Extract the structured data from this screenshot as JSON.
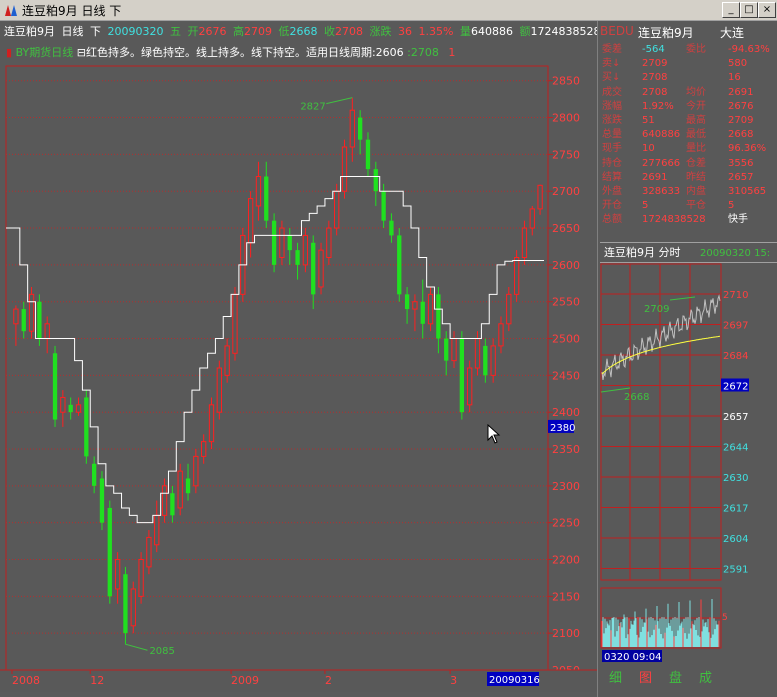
{
  "window": {
    "title": "连豆粕9月  日线  下",
    "min_label": "_",
    "max_label": "□",
    "close_label": "×"
  },
  "quote_bar": {
    "name": "连豆粕9月",
    "period": "日线",
    "direction": "下",
    "date": "20090320",
    "weekday": "五",
    "open_label": "开",
    "open": "2676",
    "high_label": "高",
    "high": "2709",
    "low_label": "低",
    "low": "2668",
    "close_label": "收",
    "close": "2708",
    "change_label": "涨跌",
    "change": "36",
    "pct": "1.35%",
    "vol_label": "量",
    "vol": "640886",
    "amt_label": "额",
    "amt": "1724838528",
    "oi_label": "仓",
    "oi": "2776"
  },
  "indicator_bar": {
    "name": "BY期货日线",
    "desc": "红色持多。绿色持空。线上持多。线下持空。适用日线周期:2606",
    "val1": ":2708",
    "val2": "1"
  },
  "chart_data": {
    "type": "candlestick",
    "y_ticks": [
      "2850",
      "2800",
      "2750",
      "2700",
      "2650",
      "2600",
      "2550",
      "2500",
      "2450",
      "2400",
      "2350",
      "2300",
      "2250",
      "2200",
      "2150",
      "2100",
      "2050"
    ],
    "ylim": [
      2050,
      2870
    ],
    "x_labels": [
      "2008",
      "12",
      "2009",
      "2",
      "3"
    ],
    "cursor_date": "20090316",
    "cursor_price": "2380",
    "high_annotation": "2827",
    "low_annotation": "2085",
    "candles": [
      [
        2520,
        2540,
        2490,
        2545
      ],
      [
        2540,
        2510,
        2500,
        2550
      ],
      [
        2510,
        2560,
        2500,
        2570
      ],
      [
        2550,
        2500,
        2490,
        2560
      ],
      [
        2500,
        2520,
        2480,
        2530
      ],
      [
        2480,
        2390,
        2380,
        2490
      ],
      [
        2400,
        2420,
        2380,
        2430
      ],
      [
        2410,
        2400,
        2390,
        2420
      ],
      [
        2400,
        2410,
        2395,
        2420
      ],
      [
        2420,
        2340,
        2330,
        2430
      ],
      [
        2330,
        2300,
        2290,
        2340
      ],
      [
        2310,
        2250,
        2240,
        2320
      ],
      [
        2270,
        2150,
        2140,
        2280
      ],
      [
        2160,
        2200,
        2140,
        2210
      ],
      [
        2180,
        2100,
        2085,
        2190
      ],
      [
        2110,
        2160,
        2100,
        2170
      ],
      [
        2150,
        2200,
        2140,
        2210
      ],
      [
        2190,
        2230,
        2180,
        2240
      ],
      [
        2220,
        2260,
        2210,
        2280
      ],
      [
        2260,
        2300,
        2250,
        2310
      ],
      [
        2290,
        2260,
        2250,
        2300
      ],
      [
        2270,
        2320,
        2260,
        2330
      ],
      [
        2310,
        2290,
        2280,
        2330
      ],
      [
        2300,
        2340,
        2290,
        2350
      ],
      [
        2340,
        2360,
        2330,
        2370
      ],
      [
        2360,
        2410,
        2350,
        2420
      ],
      [
        2400,
        2460,
        2390,
        2470
      ],
      [
        2450,
        2490,
        2440,
        2500
      ],
      [
        2480,
        2560,
        2470,
        2570
      ],
      [
        2560,
        2640,
        2550,
        2650
      ],
      [
        2630,
        2690,
        2610,
        2700
      ],
      [
        2680,
        2720,
        2660,
        2740
      ],
      [
        2720,
        2660,
        2650,
        2740
      ],
      [
        2660,
        2600,
        2590,
        2670
      ],
      [
        2610,
        2650,
        2600,
        2660
      ],
      [
        2640,
        2620,
        2600,
        2650
      ],
      [
        2620,
        2600,
        2580,
        2630
      ],
      [
        2600,
        2640,
        2590,
        2650
      ],
      [
        2630,
        2560,
        2540,
        2640
      ],
      [
        2570,
        2620,
        2560,
        2630
      ],
      [
        2610,
        2650,
        2600,
        2660
      ],
      [
        2650,
        2700,
        2640,
        2710
      ],
      [
        2700,
        2760,
        2690,
        2770
      ],
      [
        2760,
        2810,
        2740,
        2827
      ],
      [
        2800,
        2770,
        2750,
        2810
      ],
      [
        2770,
        2730,
        2720,
        2780
      ],
      [
        2730,
        2700,
        2680,
        2740
      ],
      [
        2700,
        2660,
        2650,
        2710
      ],
      [
        2660,
        2640,
        2630,
        2670
      ],
      [
        2640,
        2560,
        2550,
        2650
      ],
      [
        2560,
        2540,
        2520,
        2570
      ],
      [
        2540,
        2550,
        2510,
        2560
      ],
      [
        2550,
        2520,
        2500,
        2580
      ],
      [
        2520,
        2560,
        2510,
        2570
      ],
      [
        2560,
        2500,
        2480,
        2570
      ],
      [
        2500,
        2470,
        2450,
        2510
      ],
      [
        2470,
        2500,
        2460,
        2510
      ],
      [
        2500,
        2400,
        2390,
        2510
      ],
      [
        2410,
        2460,
        2400,
        2470
      ],
      [
        2460,
        2500,
        2450,
        2510
      ],
      [
        2490,
        2450,
        2440,
        2500
      ],
      [
        2450,
        2490,
        2440,
        2500
      ],
      [
        2490,
        2520,
        2480,
        2530
      ],
      [
        2520,
        2560,
        2510,
        2570
      ],
      [
        2560,
        2610,
        2550,
        2620
      ],
      [
        2610,
        2650,
        2600,
        2660
      ],
      [
        2650,
        2676,
        2640,
        2680
      ],
      [
        2676,
        2708,
        2668,
        2709
      ]
    ],
    "stop_line": [
      2650,
      2600,
      2550,
      2500,
      2500,
      2500,
      2500,
      2500,
      2470,
      2430,
      2380,
      2330,
      2300,
      2290,
      2270,
      2260,
      2250,
      2250,
      2260,
      2290,
      2320,
      2360,
      2400,
      2430,
      2460,
      2480,
      2500,
      2530,
      2560,
      2600,
      2630,
      2640,
      2640,
      2640,
      2640,
      2640,
      2640,
      2660,
      2670,
      2680,
      2690,
      2700,
      2720,
      2720,
      2720,
      2720,
      2720,
      2700,
      2700,
      2700,
      2680,
      2650,
      2610,
      2570,
      2540,
      2520,
      2500,
      2500,
      2500,
      2500,
      2520,
      2560,
      2600,
      2605,
      2606,
      2606,
      2606,
      2606
    ]
  },
  "right_panel": {
    "code": "BEDU",
    "name": "连豆粕9月",
    "exchange": "大连",
    "rows": [
      {
        "l1": "委差",
        "v1": "-564",
        "l2": "委比",
        "v2": "-94.63%"
      },
      {
        "l1": "卖↓",
        "v1": "2709",
        "l2": "",
        "v2": "580"
      },
      {
        "l1": "买↓",
        "v1": "2708",
        "l2": "",
        "v2": "16"
      },
      {
        "l1": "成交",
        "v1": "2708",
        "l2": "均价",
        "v2": "2691"
      },
      {
        "l1": "涨幅",
        "v1": "1.92%",
        "l2": "今开",
        "v2": "2676"
      },
      {
        "l1": "涨跌",
        "v1": "51",
        "l2": "最高",
        "v2": "2709"
      },
      {
        "l1": "总量",
        "v1": "640886",
        "l2": "最低",
        "v2": "2668"
      },
      {
        "l1": "现手",
        "v1": "10",
        "l2": "量比",
        "v2": "96.36%"
      },
      {
        "l1": "持仓",
        "v1": "277666",
        "l2": "仓差",
        "v2": "3556"
      },
      {
        "l1": "结算",
        "v1": "2691",
        "l2": "昨结",
        "v2": "2657"
      },
      {
        "l1": "外盘",
        "v1": "328633",
        "l2": "内盘",
        "v2": "310565"
      },
      {
        "l1": "开仓",
        "v1": "5",
        "l2": "平仓",
        "v2": "5"
      },
      {
        "l1": "总额",
        "v1": "1724838528",
        "l2": "",
        "v2": "快手"
      }
    ],
    "mini": {
      "title": "连豆粕9月  分时",
      "date": "20090320  15:",
      "y_labels": [
        "2710",
        "2697",
        "2684",
        "2672",
        "2657",
        "2644",
        "2630",
        "2617",
        "2604",
        "2591"
      ],
      "hi_label": "2709",
      "lo_label": "2668",
      "vol_label": "5",
      "time_label": "0320 09:04"
    },
    "tabs": [
      "细",
      "图",
      "盘",
      "成"
    ]
  }
}
